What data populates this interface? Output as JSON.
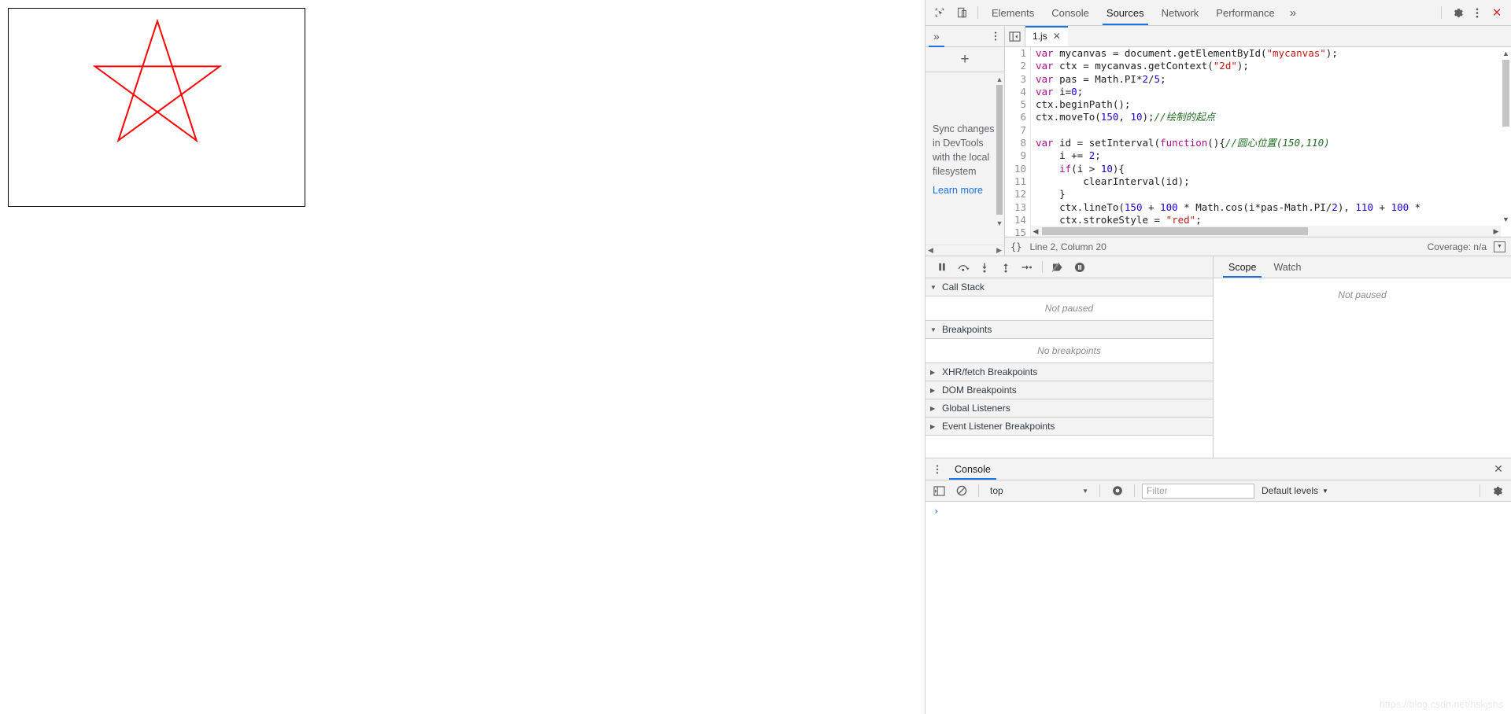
{
  "page": {
    "canvas": {
      "name": "mycanvas",
      "stroke_color": "#ff0000",
      "border_color": "#000000",
      "shape": "five-pointed-star"
    }
  },
  "devtools": {
    "toolbar": {
      "inspect_icon": "inspect-element-icon",
      "device_icon": "device-toolbar-icon",
      "tabs": [
        {
          "label": "Elements",
          "active": false
        },
        {
          "label": "Console",
          "active": false
        },
        {
          "label": "Sources",
          "active": true
        },
        {
          "label": "Network",
          "active": false
        },
        {
          "label": "Performance",
          "active": false
        }
      ],
      "more_tabs": "»",
      "settings_icon": "gear-icon",
      "menu_icon": "kebab-menu-icon",
      "close_label": "✕"
    },
    "navigator": {
      "more_tabs": "»",
      "menu_icon": "kebab-menu-icon",
      "add_label": "+",
      "message": "Sync changes in DevTools with the local filesystem",
      "learn_more": "Learn more"
    },
    "editor": {
      "panel_toggle_icon": "show-navigator-icon",
      "file_tab": {
        "name": "1.js",
        "close": "✕"
      },
      "lines": [
        {
          "n": "1",
          "tokens": [
            {
              "t": "var ",
              "c": "kw"
            },
            {
              "t": "mycanvas = document.getElementById(",
              "c": "plain"
            },
            {
              "t": "\"mycanvas\"",
              "c": "str"
            },
            {
              "t": ");",
              "c": "plain"
            }
          ]
        },
        {
          "n": "2",
          "tokens": [
            {
              "t": "var ",
              "c": "kw"
            },
            {
              "t": "ctx = mycanvas.getContext(",
              "c": "plain"
            },
            {
              "t": "\"2d\"",
              "c": "str"
            },
            {
              "t": ");",
              "c": "plain"
            }
          ]
        },
        {
          "n": "3",
          "tokens": [
            {
              "t": "var ",
              "c": "kw"
            },
            {
              "t": "pas = Math.PI*",
              "c": "plain"
            },
            {
              "t": "2",
              "c": "num"
            },
            {
              "t": "/",
              "c": "plain"
            },
            {
              "t": "5",
              "c": "num"
            },
            {
              "t": ";",
              "c": "plain"
            }
          ]
        },
        {
          "n": "4",
          "tokens": [
            {
              "t": "var ",
              "c": "kw"
            },
            {
              "t": "i=",
              "c": "plain"
            },
            {
              "t": "0",
              "c": "num"
            },
            {
              "t": ";",
              "c": "plain"
            }
          ]
        },
        {
          "n": "5",
          "tokens": [
            {
              "t": "ctx.beginPath();",
              "c": "plain"
            }
          ]
        },
        {
          "n": "6",
          "tokens": [
            {
              "t": "ctx.moveTo(",
              "c": "plain"
            },
            {
              "t": "150",
              "c": "num"
            },
            {
              "t": ", ",
              "c": "plain"
            },
            {
              "t": "10",
              "c": "num"
            },
            {
              "t": ");",
              "c": "plain"
            },
            {
              "t": "//绘制的起点",
              "c": "com"
            }
          ]
        },
        {
          "n": "7",
          "tokens": [
            {
              "t": "",
              "c": "plain"
            }
          ]
        },
        {
          "n": "8",
          "tokens": [
            {
              "t": "var ",
              "c": "kw"
            },
            {
              "t": "id = setInterval(",
              "c": "plain"
            },
            {
              "t": "function",
              "c": "kw"
            },
            {
              "t": "(){",
              "c": "plain"
            },
            {
              "t": "//圆心位置(150,110)",
              "c": "com"
            }
          ]
        },
        {
          "n": "9",
          "tokens": [
            {
              "t": "    i += ",
              "c": "plain"
            },
            {
              "t": "2",
              "c": "num"
            },
            {
              "t": ";",
              "c": "plain"
            }
          ]
        },
        {
          "n": "10",
          "tokens": [
            {
              "t": "    ",
              "c": "plain"
            },
            {
              "t": "if",
              "c": "kw"
            },
            {
              "t": "(i > ",
              "c": "plain"
            },
            {
              "t": "10",
              "c": "num"
            },
            {
              "t": "){",
              "c": "plain"
            }
          ]
        },
        {
          "n": "11",
          "tokens": [
            {
              "t": "        clearInterval(id);",
              "c": "plain"
            }
          ]
        },
        {
          "n": "12",
          "tokens": [
            {
              "t": "    }",
              "c": "plain"
            }
          ]
        },
        {
          "n": "13",
          "tokens": [
            {
              "t": "    ctx.lineTo(",
              "c": "plain"
            },
            {
              "t": "150",
              "c": "num"
            },
            {
              "t": " + ",
              "c": "plain"
            },
            {
              "t": "100",
              "c": "num"
            },
            {
              "t": " * Math.cos(i*pas-Math.PI/",
              "c": "plain"
            },
            {
              "t": "2",
              "c": "num"
            },
            {
              "t": "), ",
              "c": "plain"
            },
            {
              "t": "110",
              "c": "num"
            },
            {
              "t": " + ",
              "c": "plain"
            },
            {
              "t": "100",
              "c": "num"
            },
            {
              "t": " *",
              "c": "plain"
            }
          ]
        },
        {
          "n": "14",
          "tokens": [
            {
              "t": "    ctx.strokeStyle = ",
              "c": "plain"
            },
            {
              "t": "\"red\"",
              "c": "str"
            },
            {
              "t": ";",
              "c": "plain"
            }
          ]
        },
        {
          "n": "15",
          "tokens": [
            {
              "t": "",
              "c": "plain"
            }
          ]
        }
      ]
    },
    "status_bar": {
      "pretty_print": "{}",
      "cursor": "Line 2, Column 20",
      "coverage": "Coverage: n/a",
      "drawer_toggle_icon": "show-drawer-icon"
    },
    "debugger": {
      "controls": [
        {
          "name": "pause-script-execution",
          "icon": "pause-icon"
        },
        {
          "name": "step-over-next-function-call",
          "icon": "step-over-icon"
        },
        {
          "name": "step-into-next-function-call",
          "icon": "step-into-icon"
        },
        {
          "name": "step-out-of-current-function",
          "icon": "step-out-icon"
        },
        {
          "name": "step",
          "icon": "step-icon"
        },
        {
          "name": "deactivate-breakpoints",
          "icon": "deactivate-breakpoints-icon"
        },
        {
          "name": "pause-on-exceptions",
          "icon": "pause-on-exceptions-icon"
        }
      ],
      "sections": [
        {
          "title": "Call Stack",
          "expanded": true,
          "empty_text": "Not paused"
        },
        {
          "title": "Breakpoints",
          "expanded": true,
          "empty_text": "No breakpoints"
        },
        {
          "title": "XHR/fetch Breakpoints",
          "expanded": false,
          "empty_text": ""
        },
        {
          "title": "DOM Breakpoints",
          "expanded": false,
          "empty_text": ""
        },
        {
          "title": "Global Listeners",
          "expanded": false,
          "empty_text": ""
        },
        {
          "title": "Event Listener Breakpoints",
          "expanded": false,
          "empty_text": ""
        }
      ],
      "side_tabs": [
        {
          "label": "Scope",
          "active": true
        },
        {
          "label": "Watch",
          "active": false
        }
      ],
      "side_empty": "Not paused"
    },
    "drawer": {
      "menu_icon": "kebab-menu-icon",
      "tab": "Console",
      "close": "✕",
      "toolbar": {
        "sidebar_icon": "console-sidebar-icon",
        "clear_icon": "clear-console-icon",
        "context": "top",
        "eye_icon": "live-expression-icon",
        "filter_placeholder": "Filter",
        "filter_value": "",
        "levels": "Default levels",
        "settings_icon": "gear-icon"
      },
      "prompt": "›",
      "watermark": "https://blog.csdn.net/hskjshs"
    }
  }
}
